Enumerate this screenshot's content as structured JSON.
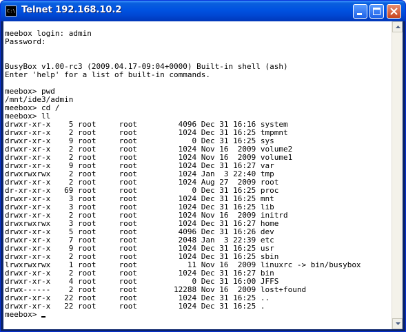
{
  "window": {
    "title": "Telnet 192.168.10.2",
    "icon": "console-icon"
  },
  "controls": {
    "minimize_icon": "minimize-icon",
    "maximize_icon": "maximize-icon",
    "close_icon": "close-icon"
  },
  "terminal": {
    "lines": [
      "meebox login: admin",
      "Password:",
      "",
      "",
      "BusyBox v1.00-rc3 (2009.04.17-09:04+0000) Built-in shell (ash)",
      "Enter 'help' for a list of built-in commands.",
      "",
      "meebox> pwd",
      "/mnt/ide3/admin",
      "meebox> cd /",
      "meebox> ll",
      "drwxr-xr-x    5 root     root         4096 Dec 31 16:16 system",
      "drwxr-xr-x    2 root     root         1024 Dec 31 16:25 tmpmnt",
      "drwxr-xr-x    9 root     root            0 Dec 31 16:25 sys",
      "drwxr-xr-x    2 root     root         1024 Nov 16  2009 volume2",
      "drwxr-xr-x    2 root     root         1024 Nov 16  2009 volume1",
      "drwxr-xr-x    9 root     root         1024 Dec 31 16:27 var",
      "drwxrwxrwx    2 root     root         1024 Jan  3 22:40 tmp",
      "drwxr-xr-x    2 root     root         1024 Aug 27  2009 root",
      "dr-xr-xr-x   69 root     root            0 Dec 31 16:25 proc",
      "drwxr-xr-x    3 root     root         1024 Dec 31 16:25 mnt",
      "drwxr-xr-x    3 root     root         1024 Dec 31 16:25 lib",
      "drwxr-xr-x    2 root     root         1024 Nov 16  2009 initrd",
      "drwxrwxrwx    3 root     root         1024 Dec 31 16:27 home",
      "drwxr-xr-x    5 root     root         4096 Dec 31 16:26 dev",
      "drwxr-xr-x    7 root     root         2048 Jan  3 22:39 etc",
      "drwxr-xr-x    9 root     root         1024 Dec 31 16:25 usr",
      "drwxr-xr-x    2 root     root         1024 Dec 31 16:25 sbin",
      "lrwxrwxrwx    1 root     root           11 Nov 16  2009 linuxrc -> bin/busybox",
      "drwxr-xr-x    2 root     root         1024 Dec 31 16:27 bin",
      "drwxr-xr-x    4 root     root            0 Dec 31 16:00 JFFS",
      "drwx------    2 root     root        12288 Nov 16  2009 lost+found",
      "drwxr-xr-x   22 root     root         1024 Dec 31 16:25 ..",
      "drwxr-xr-x   22 root     root         1024 Dec 31 16:25 .",
      "meebox> "
    ]
  },
  "scrollbar": {
    "up_icon": "scroll-up-arrow-icon",
    "down_icon": "scroll-down-arrow-icon",
    "position": 1.0
  },
  "colors": {
    "title_bar": "#0052e0",
    "close_button": "#c8461e",
    "terminal_bg": "#ffffff",
    "terminal_fg": "#000000"
  }
}
